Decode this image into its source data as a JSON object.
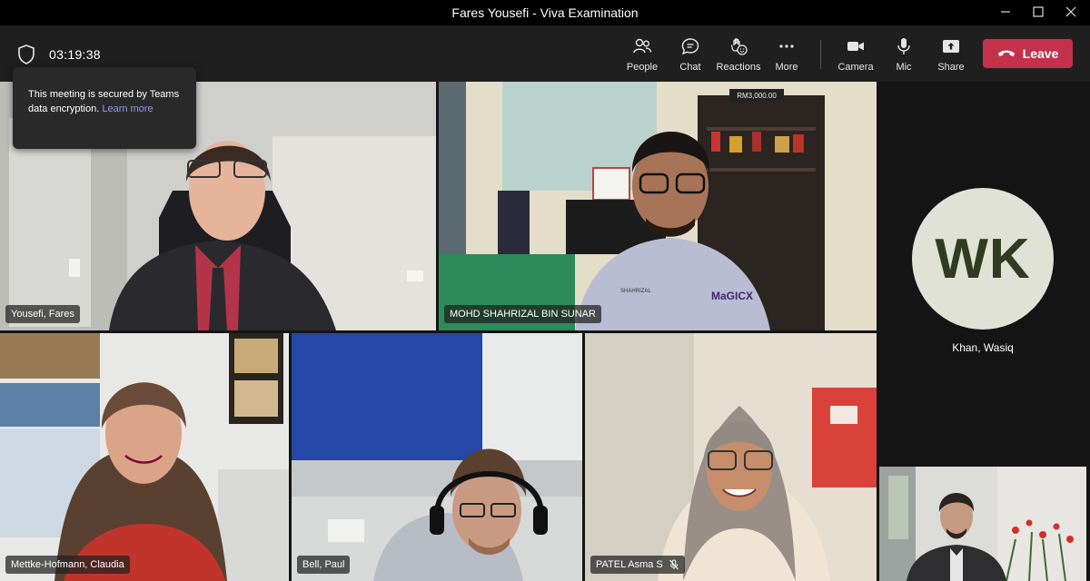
{
  "window": {
    "title": "Fares Yousefi - Viva Examination"
  },
  "toolbar": {
    "timer": "03:19:38",
    "people_label": "People",
    "chat_label": "Chat",
    "reactions_label": "Reactions",
    "more_label": "More",
    "camera_label": "Camera",
    "mic_label": "Mic",
    "share_label": "Share",
    "leave_label": "Leave",
    "leave_color": "#c4314b"
  },
  "popup": {
    "text": "This meeting is secured by Teams data encryption.",
    "link": "Learn more"
  },
  "participants": [
    {
      "name": "Yousefi, Fares"
    },
    {
      "name": "MOHD SHAHRIZAL BIN SUNAR"
    },
    {
      "name": "Khan, Wasiq",
      "initials": "WK"
    },
    {
      "name": "Mettke-Hofmann, Claudia"
    },
    {
      "name": "Bell, Paul"
    },
    {
      "name": "PATEL Asma S",
      "muted": true
    },
    {
      "name": ""
    }
  ],
  "icons": {
    "window": [
      "minimize-icon",
      "maximize-icon",
      "close-icon"
    ],
    "toolbar": [
      "shield-icon",
      "people-icon",
      "chat-icon",
      "reactions-icon",
      "more-icon",
      "camera-icon",
      "mic-icon",
      "share-icon",
      "phone-hangup-icon"
    ],
    "tag": "mic-off-icon"
  },
  "colors": {
    "accent_link": "#8e9bf2",
    "toolbar_bg": "#1f1f1f",
    "avatar_bg": "#dfe2d5"
  }
}
